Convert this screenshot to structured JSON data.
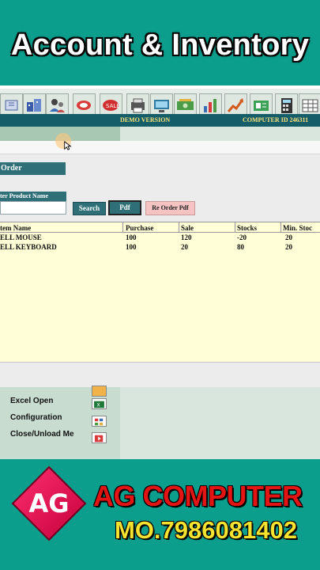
{
  "banner": {
    "title": "Account & Inventory"
  },
  "statusbar": {
    "demo": "DEMO VERSION",
    "computer_id": "COMPUTER ID  246311"
  },
  "dialog": {
    "order_label": "Order",
    "product_label": "ter Product Name",
    "product_value": "",
    "search_label": "Search",
    "pdf_label": "Pdf",
    "reorder_label": "Re Order Pdf"
  },
  "table": {
    "columns": [
      "tem Name",
      "Purchase",
      "Sale",
      "Stocks",
      "Min. Stoc"
    ],
    "rows": [
      [
        "ELL MOUSE",
        "100",
        "120",
        "-20",
        "20"
      ],
      [
        "ELL KEYBOARD",
        "100",
        "20",
        "80",
        "20"
      ]
    ]
  },
  "menu": {
    "items": [
      "Excel Open",
      "Configuration",
      "Close/Unload Me"
    ]
  },
  "icons": {
    "toolbar": [
      "window-icon",
      "company-icon",
      "users-icon",
      "alert-icon",
      "sale-icon",
      "printer-icon",
      "computer-icon",
      "cash-icon",
      "chart-icon",
      "trend-icon",
      "card-icon",
      "calculator-icon",
      "grid-icon"
    ]
  },
  "branding": {
    "logo_text": "AG",
    "company": "AG COMPUTER",
    "mobile": "MO.7986081402"
  },
  "colors": {
    "background": "#0c9e8d",
    "header_teal": "#2e6f78",
    "table_bg": "#fffed6",
    "brand_red": "#e31414",
    "mobile_yellow": "#f5e32f"
  }
}
